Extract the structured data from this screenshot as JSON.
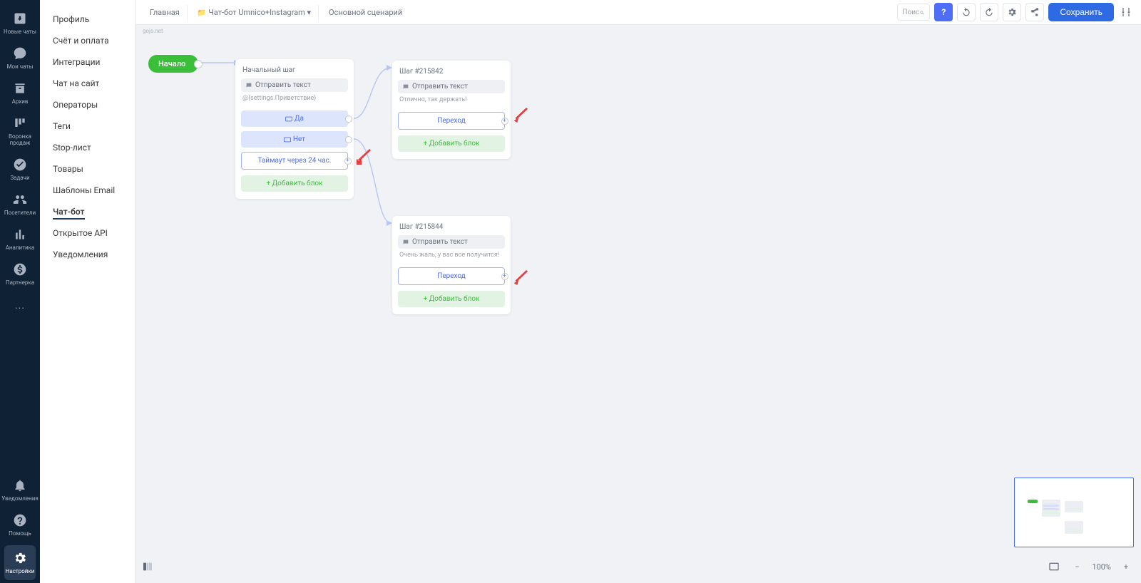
{
  "rail": {
    "items": [
      {
        "label": "Новые чаты",
        "icon": "inbox-download-icon"
      },
      {
        "label": "Мои чаты",
        "icon": "chat-icon"
      },
      {
        "label": "Архив",
        "icon": "archive-icon"
      },
      {
        "label": "Воронка продаж",
        "icon": "kanban-icon"
      },
      {
        "label": "Задачи",
        "icon": "check-circle-icon"
      },
      {
        "label": "Посетители",
        "icon": "users-icon"
      },
      {
        "label": "Аналитика",
        "icon": "chart-bar-icon"
      },
      {
        "label": "Партнерка",
        "icon": "dollar-icon"
      }
    ],
    "more": "...",
    "bottom": [
      {
        "label": "Уведомления",
        "icon": "bell-icon"
      },
      {
        "label": "Помощь",
        "icon": "help-icon"
      },
      {
        "label": "Настройки",
        "icon": "gear-icon"
      }
    ]
  },
  "settings_menu": [
    "Профиль",
    "Счёт и оплата",
    "Интеграции",
    "Чат на сайт",
    "Операторы",
    "Теги",
    "Stop-лист",
    "Товары",
    "Шаблоны Email",
    "Чат-бот",
    "Открытое API",
    "Уведомления"
  ],
  "settings_active": "Чат-бот",
  "breadcrumb": {
    "home": "Главная",
    "folder": "Чат-бот Umnico+Instagram",
    "scenario": "Основной сценарий"
  },
  "header": {
    "search_placeholder": "Поис",
    "help": "?",
    "save": "Сохранить"
  },
  "canvas": {
    "start": "Начало",
    "watermark": "gojs.net",
    "node1": {
      "title": "Начальный шаг",
      "action": "Отправить текст",
      "preview": "@{settings.Приветствие}",
      "opt_yes": "Да",
      "opt_no": "Нет",
      "timeout": "Таймаут через 24 час.",
      "add": "+ Добавить блок"
    },
    "node2": {
      "title": "Шаг #215842",
      "action": "Отправить текст",
      "preview": "Отлично, так держать!",
      "transition": "Переход",
      "add": "+ Добавить блок"
    },
    "node3": {
      "title": "Шаг #215844",
      "action": "Отправить текст",
      "preview": "Очень жаль, у вас все получится!",
      "transition": "Переход",
      "add": "+ Добавить блок"
    }
  },
  "zoom": {
    "level": "100%"
  }
}
